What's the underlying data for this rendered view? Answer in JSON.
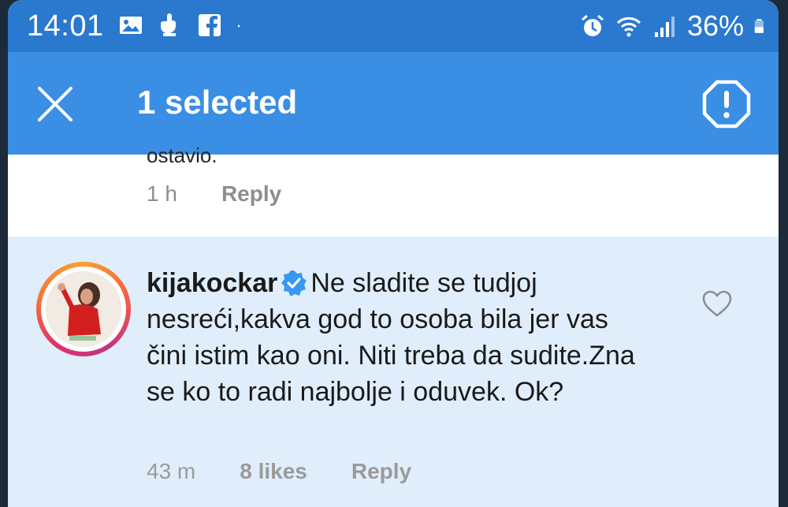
{
  "status_bar": {
    "time": "14:01",
    "battery": "36%",
    "left_icons": [
      "gallery-icon",
      "hand-icon",
      "facebook-icon",
      "dot-icon"
    ],
    "right_icons": [
      "alarm-icon",
      "wifi-icon",
      "signal-icon",
      "battery-icon"
    ]
  },
  "app_bar": {
    "title": "1 selected",
    "close_icon": "close-icon",
    "report_icon": "report-icon"
  },
  "previous_comment": {
    "text_fragment": "ostavio.",
    "time": "1 h",
    "reply_label": "Reply"
  },
  "selected_comment": {
    "username": "kijakockar",
    "verified": true,
    "text": "Ne sladite se tudjoj nesreći,kakva god to osoba bila jer vas čini istim kao oni. Niti treba da sudite.Zna se ko to radi najbolje i oduvek. Ok?",
    "time": "43 m",
    "likes": "8 likes",
    "reply_label": "Reply",
    "like_icon": "heart-outline-icon"
  },
  "colors": {
    "status_bar": "#2a79cf",
    "app_bar": "#3a8ee4",
    "selected_bg": "#e0eefb",
    "meta_text": "#8e8e8e",
    "verified_badge": "#3897f0"
  }
}
